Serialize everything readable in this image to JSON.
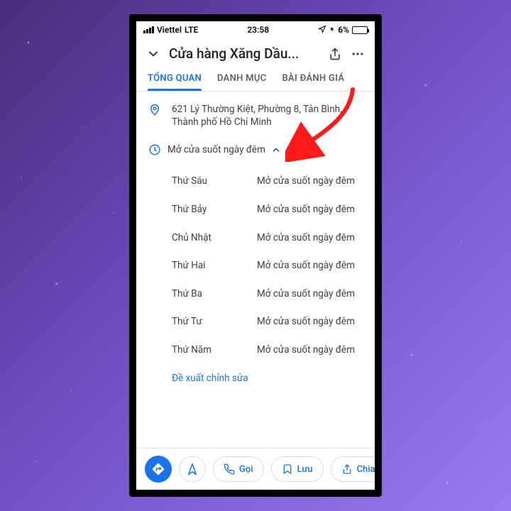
{
  "status": {
    "carrier": "Viettel",
    "network": "LTE",
    "time": "23:58",
    "battery_pct": "6%"
  },
  "header": {
    "title": "Cửa hàng Xăng Dầu..."
  },
  "tabs": {
    "overview": "TỔNG QUAN",
    "menu": "DANH MỤC",
    "reviews": "BÀI ĐÁNH GIÁ"
  },
  "address": "621 Lý Thường Kiệt, Phường 8, Tân Bình, Thành phố Hồ Chí Minh",
  "hours": {
    "summary": "Mở cửa suốt ngày đêm",
    "days": [
      {
        "day": "Thứ Sáu",
        "val": "Mở cửa suốt ngày đêm"
      },
      {
        "day": "Thứ Bảy",
        "val": "Mở cửa suốt ngày đêm"
      },
      {
        "day": "Chủ Nhật",
        "val": "Mở cửa suốt ngày đêm"
      },
      {
        "day": "Thứ Hai",
        "val": "Mở cửa suốt ngày đêm"
      },
      {
        "day": "Thứ Ba",
        "val": "Mở cửa suốt ngày đêm"
      },
      {
        "day": "Thứ Tư",
        "val": "Mở cửa suốt ngày đêm"
      },
      {
        "day": "Thứ Năm",
        "val": "Mở cửa suốt ngày đêm"
      }
    ]
  },
  "suggest_edit": "Đề xuất chỉnh sửa",
  "actions": {
    "call": "Gọi",
    "save": "Lưu",
    "share": "Chia sẻ"
  }
}
